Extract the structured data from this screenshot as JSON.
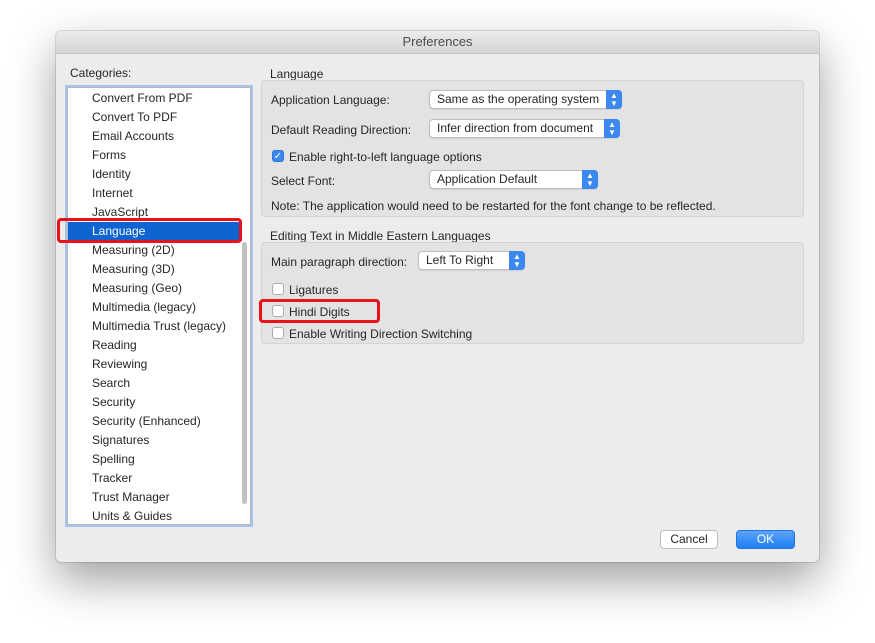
{
  "window": {
    "title": "Preferences"
  },
  "categories": {
    "label": "Categories:",
    "items": [
      "Convert From PDF",
      "Convert To PDF",
      "Email Accounts",
      "Forms",
      "Identity",
      "Internet",
      "JavaScript",
      "Language",
      "Measuring (2D)",
      "Measuring (3D)",
      "Measuring (Geo)",
      "Multimedia (legacy)",
      "Multimedia Trust (legacy)",
      "Reading",
      "Reviewing",
      "Search",
      "Security",
      "Security (Enhanced)",
      "Signatures",
      "Spelling",
      "Tracker",
      "Trust Manager",
      "Units & Guides"
    ],
    "selected": "Language"
  },
  "language_group": {
    "title": "Language",
    "app_language_label": "Application Language:",
    "app_language_value": "Same as the operating system",
    "reading_direction_label": "Default Reading Direction:",
    "reading_direction_value": "Infer direction from document",
    "rtl_checkbox_label": "Enable right-to-left language options",
    "rtl_checked": true,
    "select_font_label": "Select Font:",
    "select_font_value": "Application Default",
    "note": "Note: The application would need to be restarted for the font change to be reflected."
  },
  "middle_east_group": {
    "title": "Editing Text in Middle Eastern Languages",
    "paragraph_direction_label": "Main paragraph direction:",
    "paragraph_direction_value": "Left To Right",
    "ligatures_label": "Ligatures",
    "ligatures_checked": false,
    "hindi_digits_label": "Hindi Digits",
    "hindi_digits_checked": false,
    "writing_direction_label": "Enable Writing Direction Switching",
    "writing_direction_checked": false
  },
  "buttons": {
    "cancel": "Cancel",
    "ok": "OK"
  },
  "highlight_color": "#e8121b",
  "accent_color": "#3a88f0"
}
